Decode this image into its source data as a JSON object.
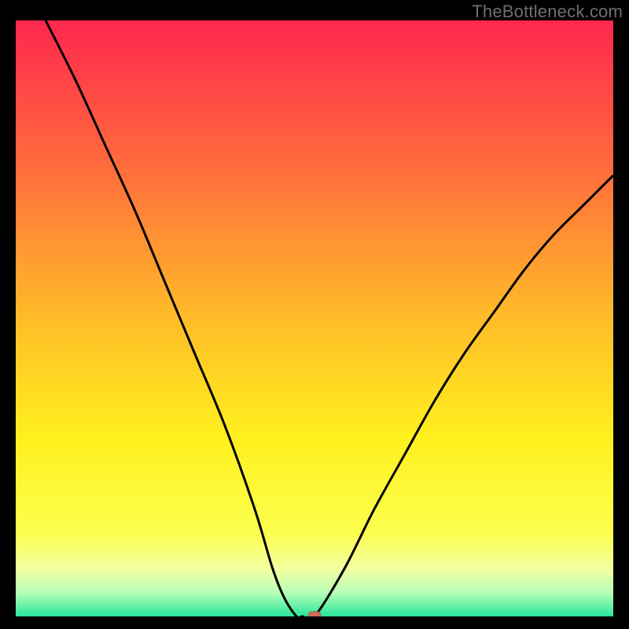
{
  "watermark": "TheBottleneck.com",
  "colors": {
    "black": "#000000",
    "curve": "#000000",
    "marker_fill": "#cf6a5b",
    "marker_stroke": "#b55a4c"
  },
  "chart_data": {
    "type": "line",
    "title": "",
    "xlabel": "",
    "ylabel": "",
    "xlim": [
      0,
      100
    ],
    "ylim": [
      0,
      100
    ],
    "grid": false,
    "legend": false,
    "annotations": [],
    "background_gradient": {
      "direction": "vertical",
      "stops": [
        {
          "pos": 0.0,
          "color": "#ff274e"
        },
        {
          "pos": 0.25,
          "color": "#ff6d3c"
        },
        {
          "pos": 0.5,
          "color": "#ffbc28"
        },
        {
          "pos": 0.7,
          "color": "#fff01e"
        },
        {
          "pos": 0.86,
          "color": "#fcff4e"
        },
        {
          "pos": 0.92,
          "color": "#f2ffa0"
        },
        {
          "pos": 0.96,
          "color": "#b8ffb8"
        },
        {
          "pos": 1.0,
          "color": "#28e59a"
        }
      ]
    },
    "series": [
      {
        "name": "bottleneck-curve",
        "x": [
          5,
          10,
          15,
          20,
          25,
          30,
          35,
          40,
          43,
          45,
          47,
          48,
          50,
          55,
          60,
          65,
          70,
          75,
          80,
          85,
          90,
          95,
          100
        ],
        "y": [
          100,
          90,
          79,
          68,
          56,
          44,
          32,
          18,
          8,
          3,
          0,
          0,
          0,
          8,
          18,
          27,
          36,
          44,
          51,
          58,
          64,
          69,
          74
        ]
      }
    ],
    "flat_segment": {
      "x_start": 43,
      "x_end": 50,
      "y": 0
    },
    "marker": {
      "x": 50,
      "y": 0,
      "shape": "rounded-rect"
    }
  }
}
